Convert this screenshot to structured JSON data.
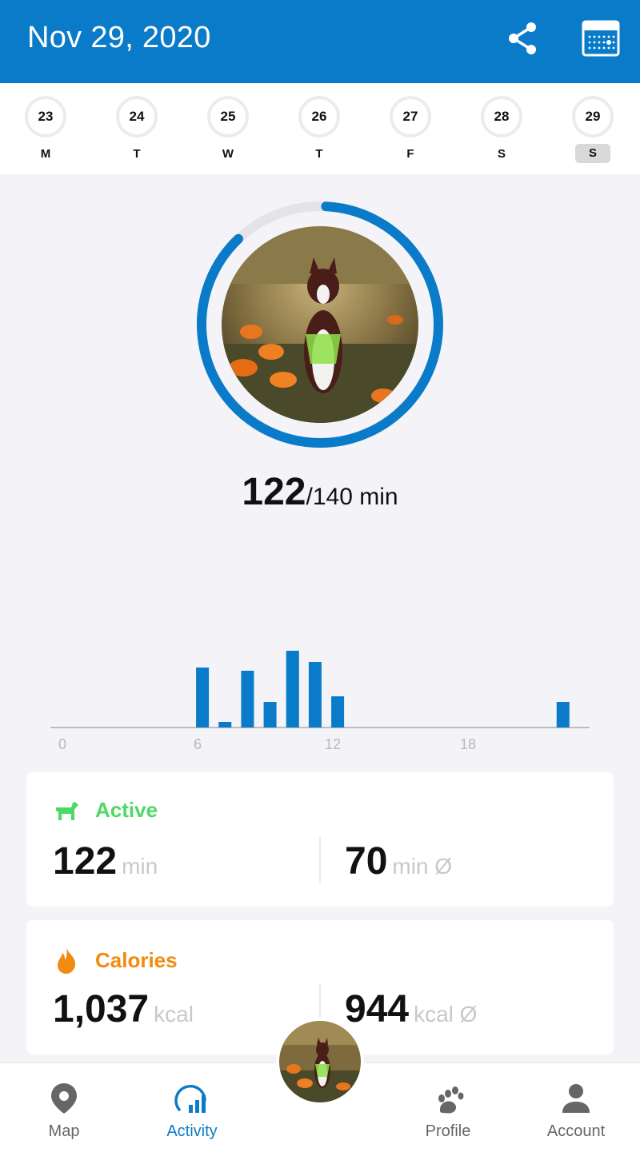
{
  "header": {
    "title": "Nov 29, 2020",
    "share_icon": "share-icon",
    "calendar_icon": "calendar-icon"
  },
  "week": {
    "days": [
      {
        "date": "23",
        "letter": "M"
      },
      {
        "date": "24",
        "letter": "T"
      },
      {
        "date": "25",
        "letter": "W"
      },
      {
        "date": "26",
        "letter": "T"
      },
      {
        "date": "27",
        "letter": "F"
      },
      {
        "date": "28",
        "letter": "S"
      },
      {
        "date": "29",
        "letter": "S",
        "selected": true
      }
    ]
  },
  "goal": {
    "value": "122",
    "target_text": "/140 min",
    "progress_fraction": 0.871
  },
  "chart_data": {
    "type": "bar",
    "x_tick_labels": [
      "0",
      "6",
      "12",
      "18"
    ],
    "x_range": [
      0,
      24
    ],
    "bars": [
      {
        "hour": 7,
        "value": 75
      },
      {
        "hour": 8,
        "value": 7
      },
      {
        "hour": 9,
        "value": 71
      },
      {
        "hour": 10,
        "value": 32
      },
      {
        "hour": 11,
        "value": 96
      },
      {
        "hour": 12,
        "value": 82
      },
      {
        "hour": 13,
        "value": 39
      },
      {
        "hour": 23,
        "value": 32
      }
    ],
    "ylim": [
      0,
      100
    ],
    "color": "#0a7bc8"
  },
  "active": {
    "label": "Active",
    "total": "122",
    "total_unit": "min",
    "avg": "70",
    "avg_unit": "min Ø",
    "color": "#4cd964",
    "icon": "dog-walking-icon"
  },
  "calories": {
    "label": "Calories",
    "total": "1,037",
    "total_unit": "kcal",
    "avg": "944",
    "avg_unit": "kcal Ø",
    "color": "#f28a0f",
    "icon": "flame-icon"
  },
  "nav": {
    "map": "Map",
    "activity": "Activity",
    "profile": "Profile",
    "account": "Account"
  },
  "colors": {
    "brand": "#0a7bc8",
    "background": "#f3f3f8"
  }
}
